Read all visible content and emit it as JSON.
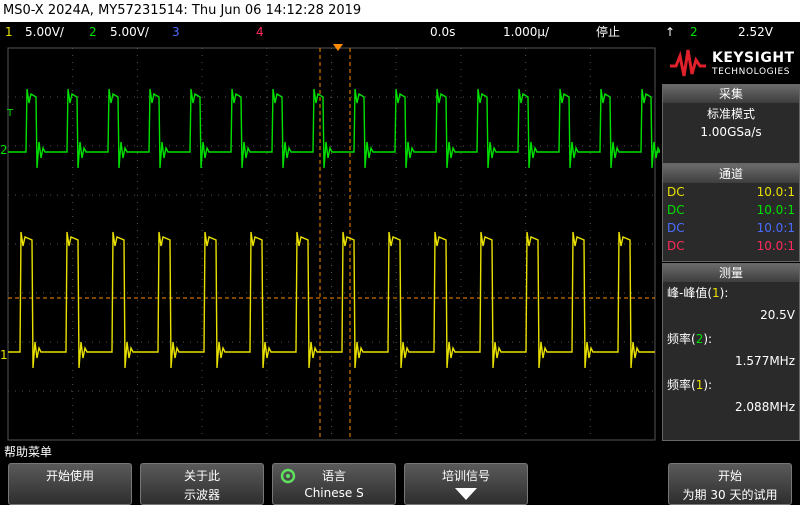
{
  "title": "MS0-X 2024A, MY57231514: Thu Jun 06 14:12:28 2019",
  "status": {
    "ch1_num": "1",
    "ch1_scale": "5.00V/",
    "ch2_num": "2",
    "ch2_scale": "5.00V/",
    "ch3_num": "3",
    "ch4_num": "4",
    "time_offset": "0.0s",
    "time_scale": "1.000µ/",
    "run_state": "停止",
    "trig_icon": "↑",
    "trig_ch": "2",
    "trig_level": "2.52V"
  },
  "colors": {
    "ch1": "#e8e000",
    "ch2": "#00e000",
    "ch3": "#4a6cff",
    "ch4": "#ff2a5a",
    "trig_marker": "#ff8c00"
  },
  "logo": {
    "brand": "KEYSIGHT",
    "sub": "TECHNOLOGIES"
  },
  "acquire": {
    "header": "采集",
    "mode": "标准模式",
    "rate": "1.00GSa/s"
  },
  "channels": {
    "header": "通道",
    "rows": [
      {
        "coupling": "DC",
        "probe": "10.0:1",
        "color": "#e8e000"
      },
      {
        "coupling": "DC",
        "probe": "10.0:1",
        "color": "#00e000"
      },
      {
        "coupling": "DC",
        "probe": "10.0:1",
        "color": "#4a6cff"
      },
      {
        "coupling": "DC",
        "probe": "10.0:1",
        "color": "#ff2a5a"
      }
    ]
  },
  "measure": {
    "header": "测量",
    "m1_prefix": "峰-峰值",
    "m1_ch": "1",
    "m1_close": "):",
    "m1_value": "20.5V",
    "m2_prefix": "频率",
    "m2_ch": "2",
    "m2_close": "):",
    "m2_value": "1.577MHz",
    "m3_prefix": "频率",
    "m3_ch": "1",
    "m3_close": "):",
    "m3_value": "2.088MHz"
  },
  "help": "帮助菜单",
  "softkeys": [
    {
      "line1": "开始使用",
      "line2": ""
    },
    {
      "line1": "关于此",
      "line2": "示波器"
    },
    {
      "line1": "语言",
      "line2": "Chinese S"
    },
    {
      "line1": "培训信号",
      "line2": ""
    },
    {
      "line1": "开始",
      "line2": "为期 30 天的试用"
    }
  ],
  "markers": {
    "ch2_label": "2",
    "ch1_label": "1",
    "trigger_label": "T"
  }
}
